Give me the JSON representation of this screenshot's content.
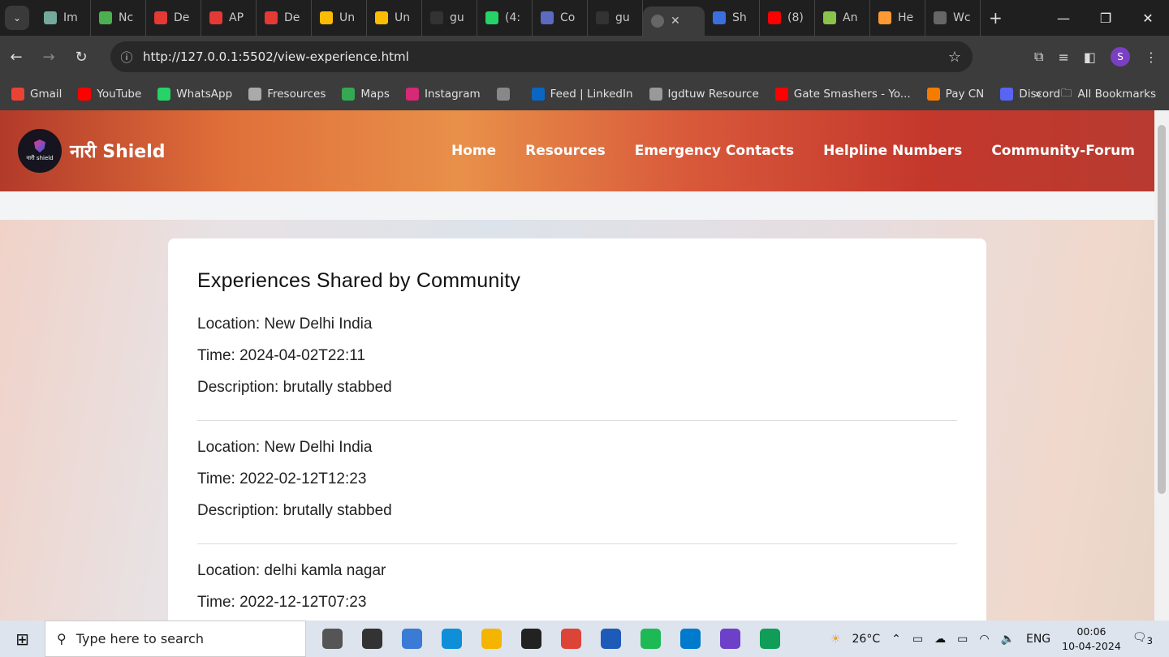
{
  "browser": {
    "tabs": [
      {
        "label": "Im",
        "color": "#74aa9c"
      },
      {
        "label": "Nc",
        "color": "#4caf50"
      },
      {
        "label": "De",
        "color": "#e53935"
      },
      {
        "label": "AP",
        "color": "#e53935"
      },
      {
        "label": "De",
        "color": "#e53935"
      },
      {
        "label": "Un",
        "color": "#fbbc04"
      },
      {
        "label": "Un",
        "color": "#fbbc04"
      },
      {
        "label": "gu",
        "color": "#333333"
      },
      {
        "label": "(4:",
        "color": "#25d366"
      },
      {
        "label": "Co",
        "color": "#5c6bc0"
      },
      {
        "label": "gu",
        "color": "#333333"
      }
    ],
    "active_tab": {
      "label": "",
      "close": "✕"
    },
    "tabs_after": [
      {
        "label": "Sh",
        "color": "#3b6fe0"
      },
      {
        "label": "(8)",
        "color": "#ff0000"
      },
      {
        "label": "An",
        "color": "#8bc34a"
      },
      {
        "label": "He",
        "color": "#ff9933"
      },
      {
        "label": "Wc",
        "color": "#666666"
      }
    ],
    "url": "http://127.0.0.1:5502/view-experience.html",
    "profile_initial": "S",
    "bookmarks": [
      {
        "label": "Gmail",
        "color": "#ea4335"
      },
      {
        "label": "YouTube",
        "color": "#ff0000"
      },
      {
        "label": "WhatsApp",
        "color": "#25d366"
      },
      {
        "label": "Fresources",
        "color": "#aaaaaa"
      },
      {
        "label": "Maps",
        "color": "#34a853"
      },
      {
        "label": "Instagram",
        "color": "#d62976"
      },
      {
        "label": "",
        "color": "#888888"
      },
      {
        "label": "Feed | LinkedIn",
        "color": "#0a66c2"
      },
      {
        "label": "Igdtuw Resource",
        "color": "#999999"
      },
      {
        "label": "Gate Smashers - Yo...",
        "color": "#ff0000"
      },
      {
        "label": "Pay CN",
        "color": "#f57c00"
      },
      {
        "label": "Discord",
        "color": "#5865f2"
      }
    ],
    "all_bookmarks": "All Bookmarks"
  },
  "site": {
    "brand": "नारी Shield",
    "logo_text": "नारी shield",
    "nav": [
      "Home",
      "Resources",
      "Emergency Contacts",
      "Helpline Numbers",
      "Community-Forum"
    ],
    "heading": "Experiences Shared by Community",
    "experiences": [
      {
        "location": "Location: New Delhi India",
        "time": "Time: 2024-04-02T22:11",
        "description": "Description: brutally stabbed"
      },
      {
        "location": "Location: New Delhi India",
        "time": "Time: 2022-02-12T12:23",
        "description": "Description: brutally stabbed"
      },
      {
        "location": "Location: delhi kamla nagar",
        "time": "Time: 2022-12-12T07:23",
        "description": ""
      }
    ]
  },
  "taskbar": {
    "search_placeholder": "Type here to search",
    "apps": [
      {
        "name": "task-view",
        "color": "#555555"
      },
      {
        "name": "unity",
        "color": "#333333"
      },
      {
        "name": "calculator",
        "color": "#3a7bd5"
      },
      {
        "name": "edge",
        "color": "#0f8fd8"
      },
      {
        "name": "file-explorer",
        "color": "#f4b400"
      },
      {
        "name": "dell",
        "color": "#222222"
      },
      {
        "name": "chrome",
        "color": "#db4437"
      },
      {
        "name": "store",
        "color": "#1e5bb8"
      },
      {
        "name": "spotify",
        "color": "#1db954"
      },
      {
        "name": "vscode",
        "color": "#007acc"
      },
      {
        "name": "github-desktop",
        "color": "#6e40c9"
      },
      {
        "name": "chrome-2",
        "color": "#0f9d58"
      }
    ],
    "weather": "26°C",
    "lang": "ENG",
    "time": "00:06",
    "date": "10-04-2024",
    "notifications": "3"
  }
}
